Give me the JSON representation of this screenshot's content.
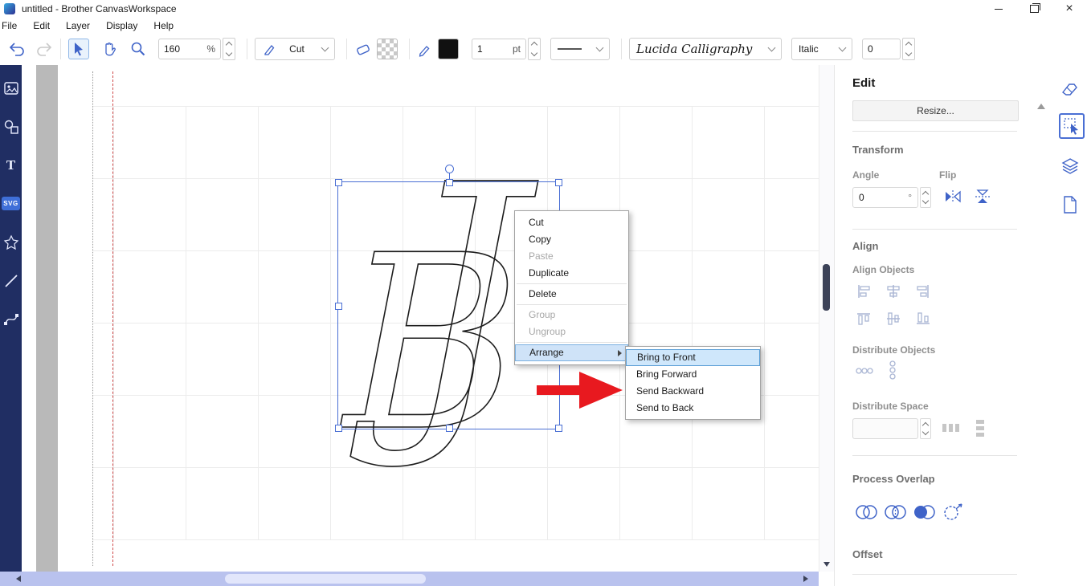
{
  "window": {
    "title": "untitled - Brother CanvasWorkspace",
    "controls": {
      "close": "×"
    }
  },
  "menu": {
    "items": [
      "File",
      "Edit",
      "Layer",
      "Display",
      "Help"
    ]
  },
  "toolbar": {
    "zoom": {
      "value": "160",
      "unit": "%"
    },
    "mode": {
      "label": "Cut"
    },
    "stroke_width": {
      "value": "1",
      "unit": "pt"
    },
    "font": {
      "family": "Lucida Calligraphy",
      "style": "Italic",
      "spacing": "0"
    }
  },
  "sidebar": {
    "svg_badge": "SVG",
    "text_tool": "T"
  },
  "canvas": {
    "monogram": {
      "letter_j": "J",
      "letter_b": "B"
    }
  },
  "context_menu": {
    "items": [
      {
        "label": "Cut"
      },
      {
        "label": "Copy"
      },
      {
        "label": "Paste"
      },
      {
        "label": "Duplicate"
      },
      {
        "label": "Delete"
      },
      {
        "label": "Group"
      },
      {
        "label": "Ungroup"
      },
      {
        "label": "Arrange"
      }
    ]
  },
  "submenu": {
    "items": [
      {
        "label": "Bring to Front"
      },
      {
        "label": "Bring Forward"
      },
      {
        "label": "Send Backward"
      },
      {
        "label": "Send to Back"
      }
    ]
  },
  "panel": {
    "title": "Edit",
    "resize_button": "Resize...",
    "transform": {
      "heading": "Transform",
      "angle_label": "Angle",
      "flip_label": "Flip",
      "angle_value": "0",
      "angle_unit": "°"
    },
    "align": {
      "heading": "Align",
      "objects_label": "Align Objects",
      "distribute_objects_label": "Distribute Objects",
      "distribute_space_label": "Distribute Space"
    },
    "process_overlap": {
      "heading": "Process Overlap"
    },
    "offset": {
      "heading": "Offset"
    }
  },
  "colors": {
    "accent": "#3f63c8",
    "selection": "#4a6fd4",
    "sidebar_bg": "#202e63",
    "menu_highlight": "#cfe7fb",
    "arrow_red": "#e8191f"
  }
}
